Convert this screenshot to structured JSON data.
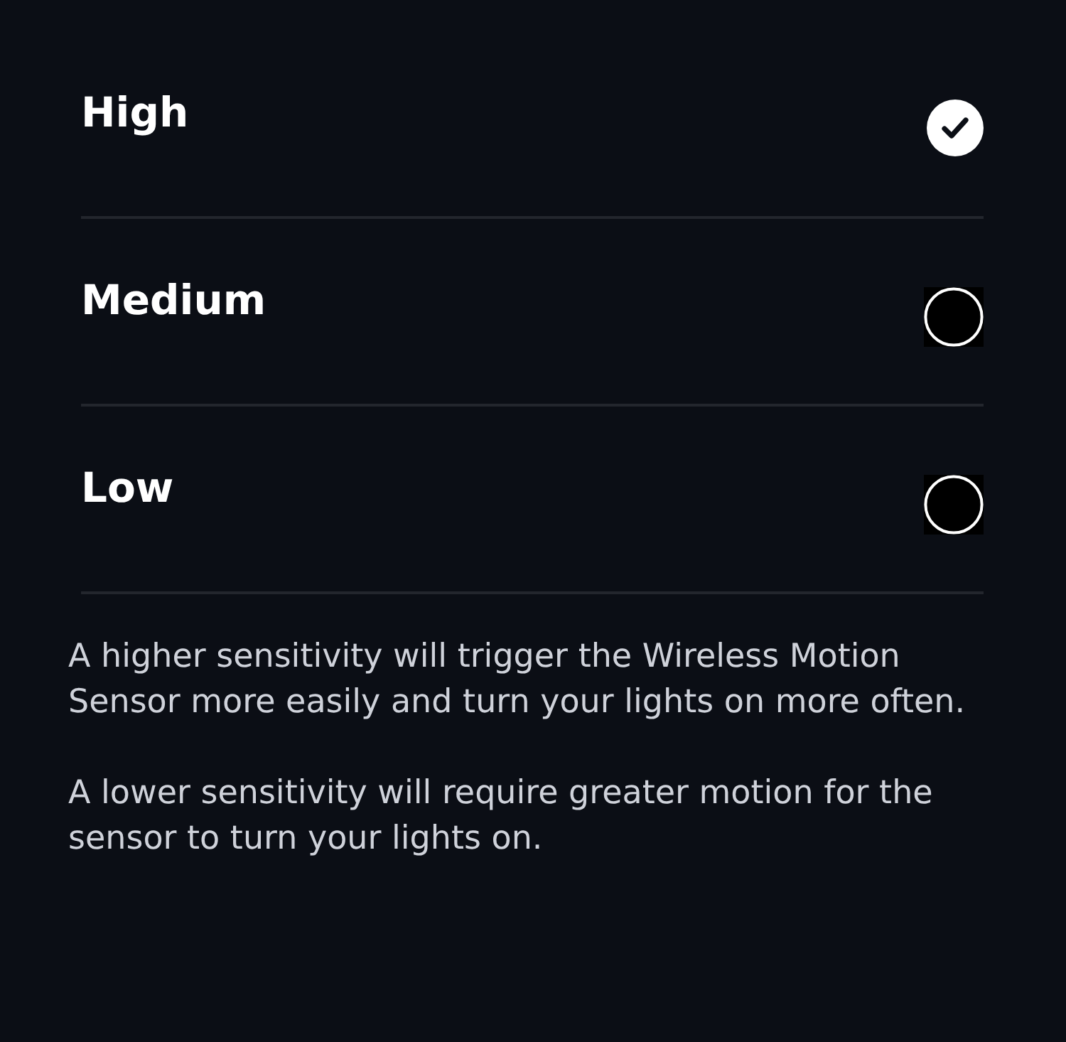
{
  "options": [
    {
      "label": "High",
      "selected": true
    },
    {
      "label": "Medium",
      "selected": false
    },
    {
      "label": "Low",
      "selected": false
    }
  ],
  "descriptions": [
    "A higher sensitivity will trigger the Wireless Motion Sensor more easily and turn your lights on more often.",
    "A lower sensitivity will require greater motion for the sensor to turn your lights on."
  ]
}
